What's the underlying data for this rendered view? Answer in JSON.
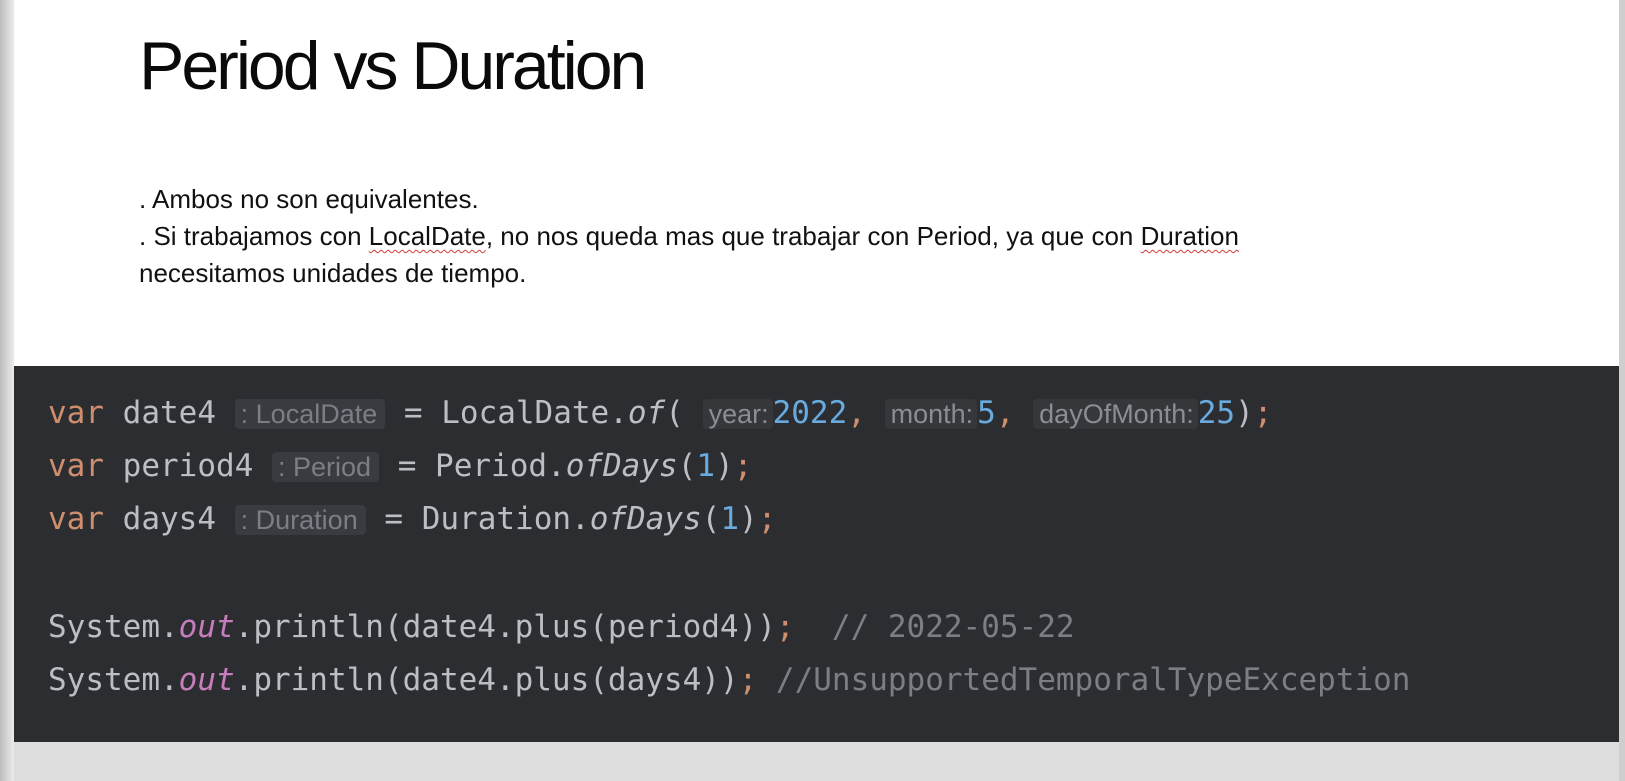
{
  "slide": {
    "title": "Period vs Duration",
    "bullets": {
      "line1": ". Ambos no son equivalentes.",
      "line2_a": ". Si trabajamos con ",
      "line2_b": "LocalDate",
      "line2_c": ", no nos queda mas que trabajar con Period, ya que con ",
      "line2_d": "Duration",
      "line3": "necesitamos unidades de tiempo."
    }
  },
  "code": {
    "line1": {
      "kw": "var",
      "name": " date4",
      "hint": ": LocalDate",
      "assign": " = LocalDate.",
      "method": "of",
      "open": "(",
      "p1_label": "year:",
      "p1_value": "2022",
      "p2_label": "month:",
      "p2_value": "5",
      "p3_label": "dayOfMonth:",
      "p3_value": "25",
      "close": ")",
      "semi": ";"
    },
    "line2": {
      "kw": "var",
      "name": " period4",
      "hint": ": Period",
      "assign": " = Period.",
      "method": "ofDays",
      "open": "(",
      "value": "1",
      "close": ")",
      "semi": ";"
    },
    "line3": {
      "kw": "var",
      "name": " days4",
      "hint": ": Duration",
      "assign": " = Duration.",
      "method": "ofDays",
      "open": "(",
      "value": "1",
      "close": ")",
      "semi": ";"
    },
    "line4": {
      "pre": "System.",
      "field": "out",
      "post": ".println(date4.plus(period4))",
      "semi": ";",
      "comment": "  // 2022-05-22"
    },
    "line5": {
      "pre": "System.",
      "field": "out",
      "post": ".println(date4.plus(days4))",
      "semi": ";",
      "comment": " //UnsupportedTemporalTypeException"
    }
  },
  "colors": {
    "keyword": "#cf8e6d",
    "number": "#6aabdf",
    "field": "#c77dbb",
    "comment": "#7a7e85",
    "code_bg": "#2b2d30"
  }
}
